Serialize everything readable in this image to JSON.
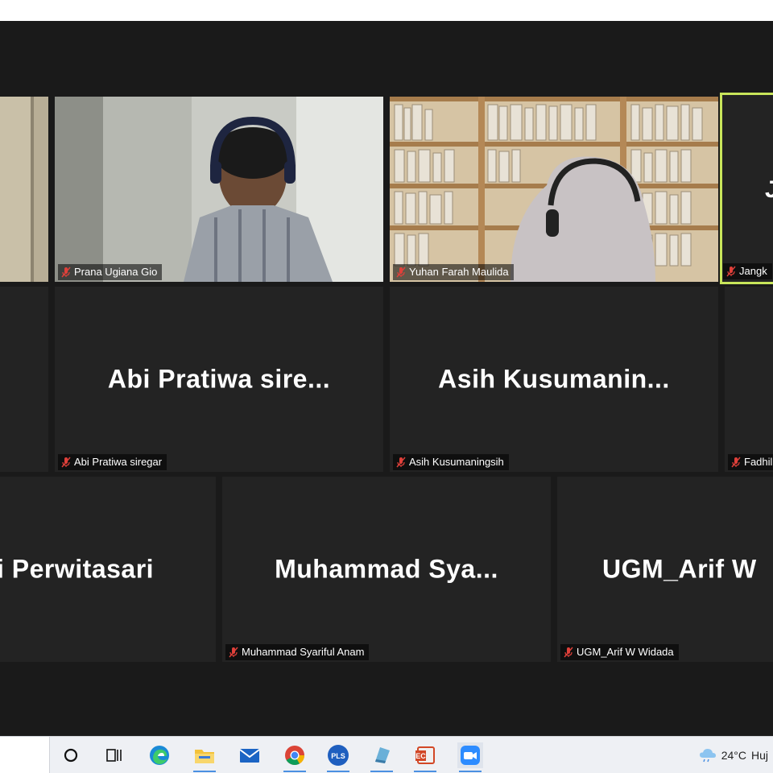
{
  "participants": {
    "row1": [
      {
        "tag": "Prana Ugiana Gio"
      },
      {
        "tag": "Yuhan Farah Maulida"
      },
      {
        "tag": "Jangk",
        "initial": "J"
      }
    ],
    "row2": [
      {
        "display": "Abi  Pratiwa  sire...",
        "tag": "Abi Pratiwa siregar"
      },
      {
        "display": "Asih  Kusumanin...",
        "tag": "Asih Kusumaningsih"
      },
      {
        "tag": "Fadhil"
      }
    ],
    "row3": [
      {
        "display": "i Perwitasari"
      },
      {
        "display": "Muhammad  Sya...",
        "tag": "Muhammad Syariful Anam"
      },
      {
        "display": "UGM_Arif  W",
        "tag": "UGM_Arif W Widada"
      }
    ]
  },
  "taskbar": {
    "icons": [
      "cortana-icon",
      "task-view-icon",
      "edge-icon",
      "file-explorer-icon",
      "mail-icon",
      "chrome-icon",
      "pls-app-icon",
      "notes-app-icon",
      "powerpoint-icon",
      "zoom-icon"
    ],
    "pls_label": "PLS",
    "weather_temp": "24°C",
    "weather_text": "Huj"
  },
  "colors": {
    "meeting_bg": "#1a1a1a",
    "tile_bg": "#232323",
    "active_speaker": "#c8e55a",
    "muted_mic": "#e0403a"
  }
}
